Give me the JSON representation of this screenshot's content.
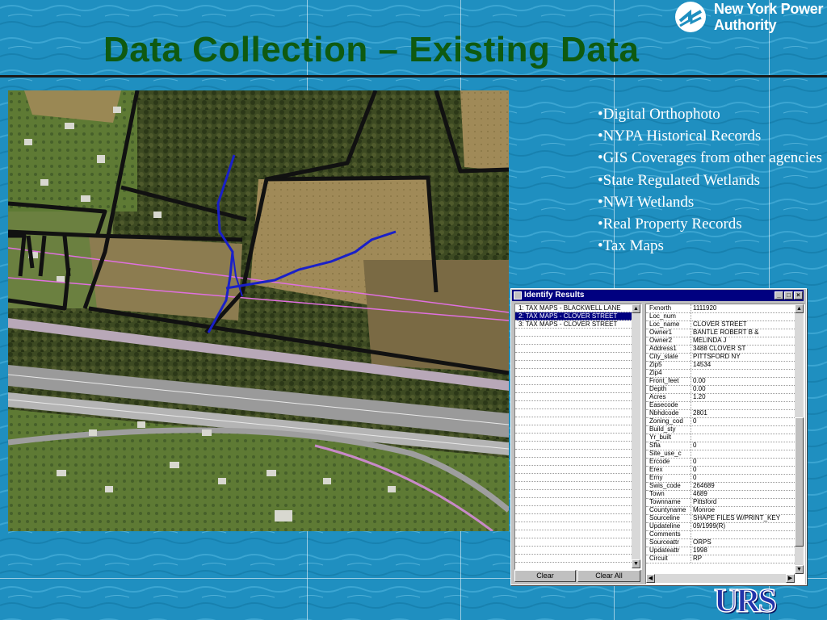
{
  "slide": {
    "title": "Data Collection – Existing Data",
    "logo": {
      "line1": "New York Power",
      "line2": "Authority"
    },
    "footer_logo": "URS",
    "bullets": [
      "•Digital Orthophoto",
      "•NYPA Historical Records",
      "•GIS Coverages from other agencies",
      "•State Regulated Wetlands",
      "•NWI Wetlands",
      "•Real Property Records",
      "•Tax Maps"
    ],
    "colors": {
      "background": "#1f8fc0",
      "title": "#0f5a10",
      "bullet_text": "#ffffff",
      "parcel_lines": "#111111",
      "stream": "#1a20c8",
      "row_lines": "#e070e0"
    }
  },
  "identify_window": {
    "title": "Identify Results",
    "buttons": {
      "minimize": "_",
      "maximize": "□",
      "close": "×"
    },
    "layers": [
      {
        "label": "1:  TAX MAPS - BLACKWELL LANE",
        "selected": false
      },
      {
        "label": "2:  TAX MAPS - CLOVER STREET",
        "selected": true
      },
      {
        "label": "3:  TAX MAPS - CLOVER STREET",
        "selected": false
      }
    ],
    "attributes": [
      {
        "field": "Fxnorth",
        "value": "1111920"
      },
      {
        "field": "Loc_num",
        "value": ""
      },
      {
        "field": "Loc_name",
        "value": "CLOVER STREET"
      },
      {
        "field": "Owner1",
        "value": "BANTLE ROBERT B &"
      },
      {
        "field": "Owner2",
        "value": "MELINDA J"
      },
      {
        "field": "Address1",
        "value": "3488 CLOVER ST"
      },
      {
        "field": "City_state",
        "value": "PITTSFORD NY"
      },
      {
        "field": "Zip5",
        "value": "14534"
      },
      {
        "field": "Zip4",
        "value": ""
      },
      {
        "field": "Front_feet",
        "value": "0.00"
      },
      {
        "field": "Depth",
        "value": "0.00"
      },
      {
        "field": "Acres",
        "value": "1.20"
      },
      {
        "field": "Easecode",
        "value": ""
      },
      {
        "field": "Nbhdcode",
        "value": "2801"
      },
      {
        "field": "Zoning_cod",
        "value": "0"
      },
      {
        "field": "Build_sty",
        "value": ""
      },
      {
        "field": "Yr_built",
        "value": ""
      },
      {
        "field": "Sfla",
        "value": "0"
      },
      {
        "field": "Site_use_c",
        "value": ""
      },
      {
        "field": "Ercode",
        "value": "0"
      },
      {
        "field": "Erex",
        "value": "0"
      },
      {
        "field": "Erny",
        "value": "0"
      },
      {
        "field": "Swis_code",
        "value": "264689"
      },
      {
        "field": "Town",
        "value": "4689"
      },
      {
        "field": "Townname",
        "value": "Pittsford"
      },
      {
        "field": "Countyname",
        "value": "Monroe"
      },
      {
        "field": "Sourceline",
        "value": "SHAPE FILES W/PRINT_KEY"
      },
      {
        "field": "Updateline",
        "value": "09/1999(R)"
      },
      {
        "field": "Comments",
        "value": ""
      },
      {
        "field": "Sourceattr",
        "value": "ORPS"
      },
      {
        "field": "Updateattr",
        "value": "1998"
      },
      {
        "field": "Circuit",
        "value": "RP"
      }
    ],
    "clear_label": "Clear",
    "clear_all_label": "Clear All",
    "scroll_up_glyph": "▲",
    "scroll_down_glyph": "▼",
    "scroll_left_glyph": "◀",
    "scroll_right_glyph": "▶"
  }
}
